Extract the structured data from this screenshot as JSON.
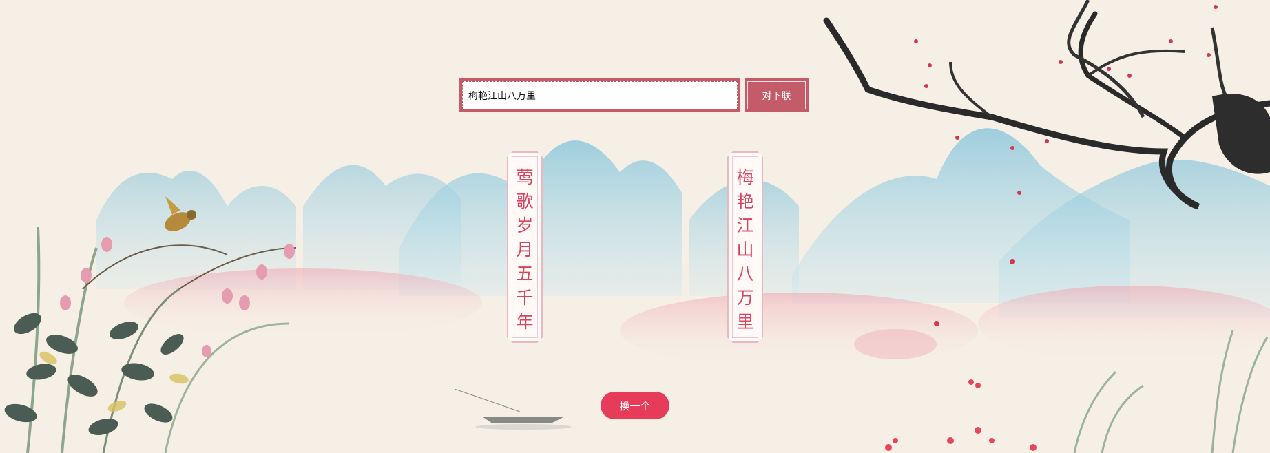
{
  "search": {
    "value": "梅艳江山八万里"
  },
  "submit": {
    "label": "对下联"
  },
  "couplet": {
    "left_chars": [
      "莺",
      "歌",
      "岁",
      "月",
      "五",
      "千",
      "年"
    ],
    "right_chars": [
      "梅",
      "艳",
      "江",
      "山",
      "八",
      "万",
      "里"
    ]
  },
  "change": {
    "label": "换一个"
  },
  "colors": {
    "accent": "#c35b69",
    "text_red": "#d8435e",
    "button": "#e63c5a",
    "paper": "#f6efe6"
  }
}
